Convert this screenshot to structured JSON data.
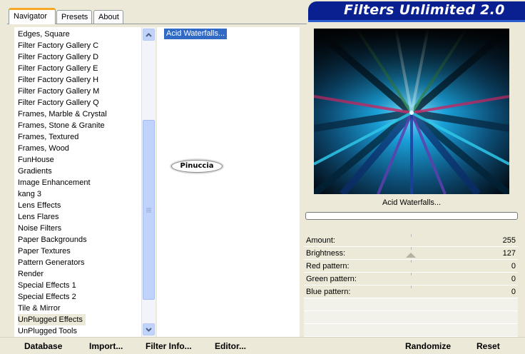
{
  "tabs": [
    "Navigator",
    "Presets",
    "About"
  ],
  "app_title": "Filters Unlimited 2.0",
  "categories": [
    "Edges, Square",
    "Filter Factory Gallery C",
    "Filter Factory Gallery D",
    "Filter Factory Gallery E",
    "Filter Factory Gallery H",
    "Filter Factory Gallery M",
    "Filter Factory Gallery Q",
    "Frames, Marble & Crystal",
    "Frames, Stone & Granite",
    "Frames, Textured",
    "Frames, Wood",
    "FunHouse",
    "Gradients",
    "Image Enhancement",
    "kang 3",
    "Lens Effects",
    "Lens Flares",
    "Noise Filters",
    "Paper Backgrounds",
    "Paper Textures",
    "Pattern Generators",
    "Render",
    "Special Effects 1",
    "Special Effects 2",
    "Tile & Mirror",
    "UnPlugged Effects",
    "UnPlugged Tools"
  ],
  "selected_category": "UnPlugged Effects",
  "filters": [
    "Acid Waterfalls..."
  ],
  "watermark": "Pinuccia",
  "preview_filter_name": "Acid Waterfalls...",
  "params": [
    {
      "label": "Amount:",
      "value": "255"
    },
    {
      "label": "Brightness:",
      "value": "127"
    },
    {
      "label": "Red pattern:",
      "value": "0"
    },
    {
      "label": "Green pattern:",
      "value": "0"
    },
    {
      "label": "Blue pattern:",
      "value": "0"
    }
  ],
  "buttons": {
    "database": "Database",
    "import": "Import...",
    "filter_info": "Filter Info...",
    "editor": "Editor...",
    "randomize": "Randomize",
    "reset": "Reset"
  },
  "colors": {
    "title_bar": "#0a2090",
    "selection": "#316ac5",
    "window_bg": "#ece9d8"
  }
}
